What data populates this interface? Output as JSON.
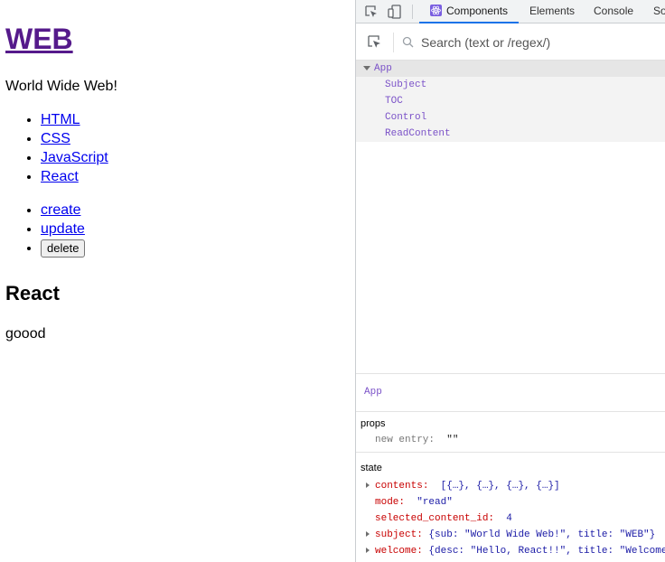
{
  "page": {
    "title": "WEB",
    "subtitle": "World Wide Web!",
    "toc": [
      "HTML",
      "CSS",
      "JavaScript",
      "React"
    ],
    "controls": {
      "create": "create",
      "update": "update",
      "delete": "delete"
    },
    "article": {
      "title": "React",
      "desc": "goood"
    }
  },
  "devtools": {
    "tabs": [
      "Components",
      "Elements",
      "Console",
      "So"
    ],
    "active_tab": "Components",
    "search": {
      "placeholder": "Search (text or /regex/)",
      "value": ""
    },
    "tree": {
      "root": "App",
      "children": [
        "Subject",
        "TOC",
        "Control",
        "ReadContent"
      ]
    },
    "selected": "App",
    "props": {
      "heading": "props",
      "items": [
        {
          "key": "new entry",
          "value": "\"\""
        }
      ]
    },
    "state": {
      "heading": "state",
      "items": [
        {
          "key": "contents",
          "value": "[{…}, {…}, {…}, {…}]",
          "expandable": true
        },
        {
          "key": "mode",
          "value": "\"read\"",
          "expandable": false
        },
        {
          "key": "selected_content_id",
          "value": "4",
          "expandable": false
        },
        {
          "key": "subject",
          "value": "{sub: \"World Wide Web!\", title: \"WEB\"}",
          "expandable": true
        },
        {
          "key": "welcome",
          "value": "{desc: \"Hello, React!!\", title: \"Welcome\"}",
          "expandable": true
        }
      ]
    }
  },
  "colors": {
    "accent": "#1a73e8",
    "component": "#7b52c8",
    "state_key": "#c80000",
    "link": "#0000ee",
    "visited": "#551a8b"
  }
}
